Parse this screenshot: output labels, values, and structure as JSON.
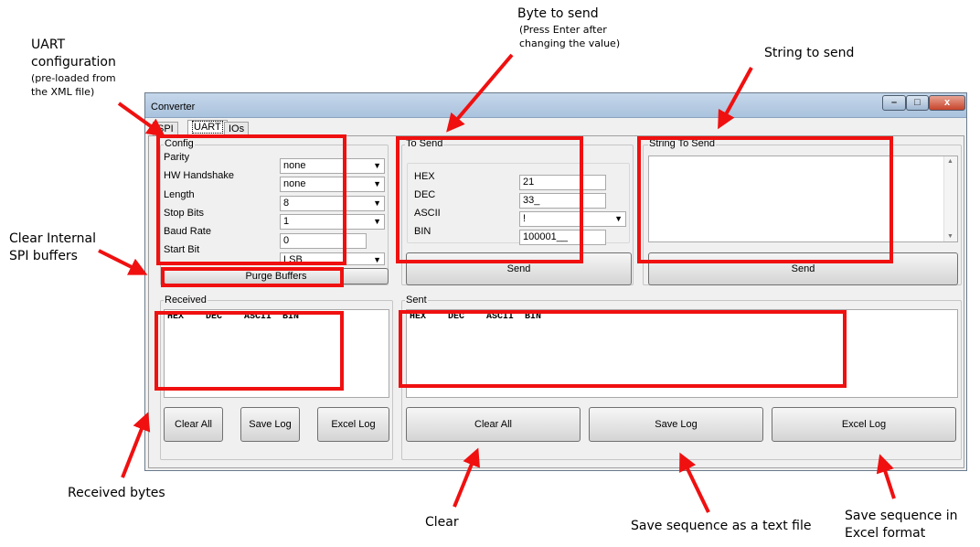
{
  "callouts": {
    "uart_config": "UART",
    "uart_config_2": "configuration",
    "uart_config_sub": "(pre-loaded from",
    "uart_config_sub2": "the XML file)",
    "byte_to_send": "Byte to send",
    "byte_to_send_sub": "(Press Enter after",
    "byte_to_send_sub2": "changing the value)",
    "string_to_send": "String to send",
    "clear_spi": "Clear Internal",
    "clear_spi_2": "SPI buffers",
    "received_bytes": "Received bytes",
    "clear": "Clear",
    "save_text": "Save sequence as a text file",
    "save_excel": "Save sequence in",
    "save_excel_2": "Excel format"
  },
  "window": {
    "title": "Converter",
    "min": "–",
    "max": "□",
    "close": "x"
  },
  "tabs": [
    "SPI",
    "UART",
    "IOs"
  ],
  "config": {
    "label": "Config",
    "parity_label": "Parity",
    "parity_value": "none",
    "hw_label": "HW Handshake",
    "hw_value": "none",
    "length_label": "Length",
    "length_value": "8",
    "stop_label": "Stop Bits",
    "stop_value": "1",
    "baud_label": "Baud Rate",
    "baud_value": "0",
    "start_label": "Start Bit",
    "start_value": "LSB",
    "purge_button": "Purge Buffers"
  },
  "to_send": {
    "label": "To Send",
    "hex_label": "HEX",
    "hex_value": "21",
    "dec_label": "DEC",
    "dec_value": "33_",
    "ascii_label": "ASCII",
    "ascii_value": "!",
    "bin_label": "BIN",
    "bin_value": "100001__",
    "send_button": "Send"
  },
  "string_to_send": {
    "label": "String To Send",
    "value": "",
    "send_button": "Send"
  },
  "received": {
    "label": "Received",
    "header": "HEX    DEC    ASCII  BIN",
    "clear_button": "Clear All",
    "save_button": "Save Log",
    "excel_button": "Excel Log"
  },
  "sent": {
    "label": "Sent",
    "header": "HEX    DEC    ASCII  BIN",
    "clear_button": "Clear All",
    "save_button": "Save Log",
    "excel_button": "Excel Log"
  },
  "colors": {
    "highlight": "#f01010",
    "arrow": "#f01010"
  }
}
